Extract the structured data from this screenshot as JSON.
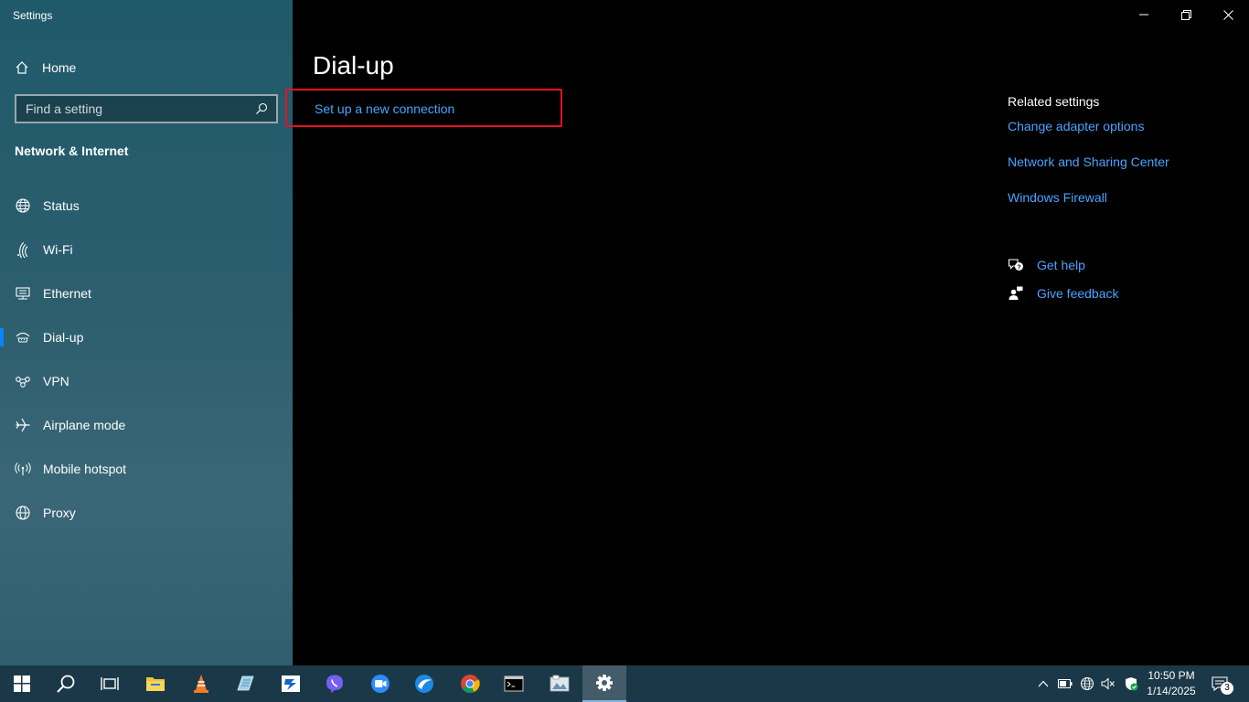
{
  "window": {
    "title": "Settings"
  },
  "sidebar": {
    "home_label": "Home",
    "search_placeholder": "Find a setting",
    "section_title": "Network & Internet",
    "items": [
      {
        "label": "Status",
        "icon": "globe-network-icon"
      },
      {
        "label": "Wi-Fi",
        "icon": "wifi-icon"
      },
      {
        "label": "Ethernet",
        "icon": "ethernet-icon"
      },
      {
        "label": "Dial-up",
        "icon": "dialup-icon",
        "active": true
      },
      {
        "label": "VPN",
        "icon": "vpn-icon"
      },
      {
        "label": "Airplane mode",
        "icon": "airplane-icon"
      },
      {
        "label": "Mobile hotspot",
        "icon": "hotspot-icon"
      },
      {
        "label": "Proxy",
        "icon": "globe-icon"
      }
    ]
  },
  "main": {
    "title": "Dial-up",
    "setup_link": "Set up a new connection"
  },
  "related": {
    "heading": "Related settings",
    "links": [
      "Change adapter options",
      "Network and Sharing Center",
      "Windows Firewall"
    ]
  },
  "help": {
    "get_help": "Get help",
    "give_feedback": "Give feedback"
  },
  "taskbar": {
    "time": "10:50 PM",
    "date": "1/14/2025",
    "notification_count": "3",
    "apps": [
      "start",
      "search",
      "task-view",
      "file-explorer",
      "vlc",
      "notepad-app",
      "remote-app",
      "viber",
      "zoom-app",
      "browser-app",
      "chrome",
      "terminal",
      "image-app",
      "settings"
    ]
  },
  "colors": {
    "accent": "#4aa3ff",
    "highlight": "#e81123",
    "taskbar": "#1b3848"
  }
}
